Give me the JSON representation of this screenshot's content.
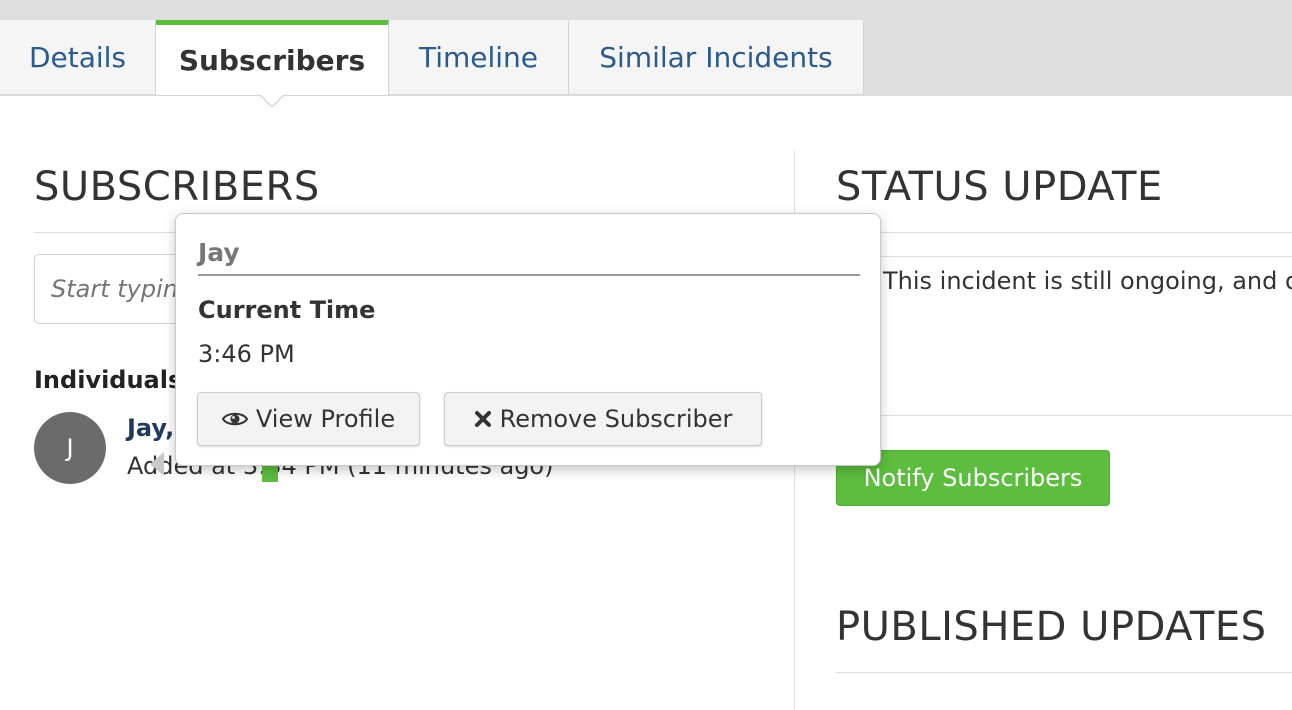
{
  "tabs": [
    {
      "label": "Details",
      "active": false
    },
    {
      "label": "Subscribers",
      "active": true
    },
    {
      "label": "Timeline",
      "active": false
    },
    {
      "label": "Similar Incidents",
      "active": false
    }
  ],
  "subscribers": {
    "heading": "SUBSCRIBERS",
    "search_placeholder": "Start typing",
    "group_label": "Individuals",
    "items": [
      {
        "initial": "J",
        "name": "Jay,",
        "added": "Added at 3:34 PM (11 minutes ago)"
      }
    ]
  },
  "status_update": {
    "heading": "STATUS UPDATE",
    "text": "This incident is still ongoing, and our team is working on it.",
    "notify_label": "Notify Subscribers"
  },
  "published_updates": {
    "heading": "PUBLISHED UPDATES"
  },
  "popover": {
    "name": "Jay",
    "time_label": "Current Time",
    "time_value": "3:46 PM",
    "view_profile_label": "View Profile",
    "remove_label": "Remove Subscriber"
  },
  "colors": {
    "accent": "#5cbd3e",
    "link": "#2b5a8e"
  }
}
